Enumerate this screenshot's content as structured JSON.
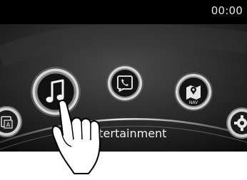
{
  "status_bar": {
    "clock": "00:00"
  },
  "home_menu": {
    "selected_label": "Entertainment",
    "items": [
      {
        "name": "applications",
        "icon": "applications-icon",
        "badge": "A",
        "selected": false
      },
      {
        "name": "entertainment",
        "icon": "music-note-icon",
        "selected": true
      },
      {
        "name": "communication",
        "icon": "phone-icon",
        "selected": false
      },
      {
        "name": "navigation",
        "icon": "nav-map-icon",
        "badge": "NAV",
        "selected": false
      },
      {
        "name": "settings",
        "icon": "gear-icon",
        "selected": false
      }
    ]
  },
  "gesture": {
    "icon": "hand-touch-icon"
  }
}
